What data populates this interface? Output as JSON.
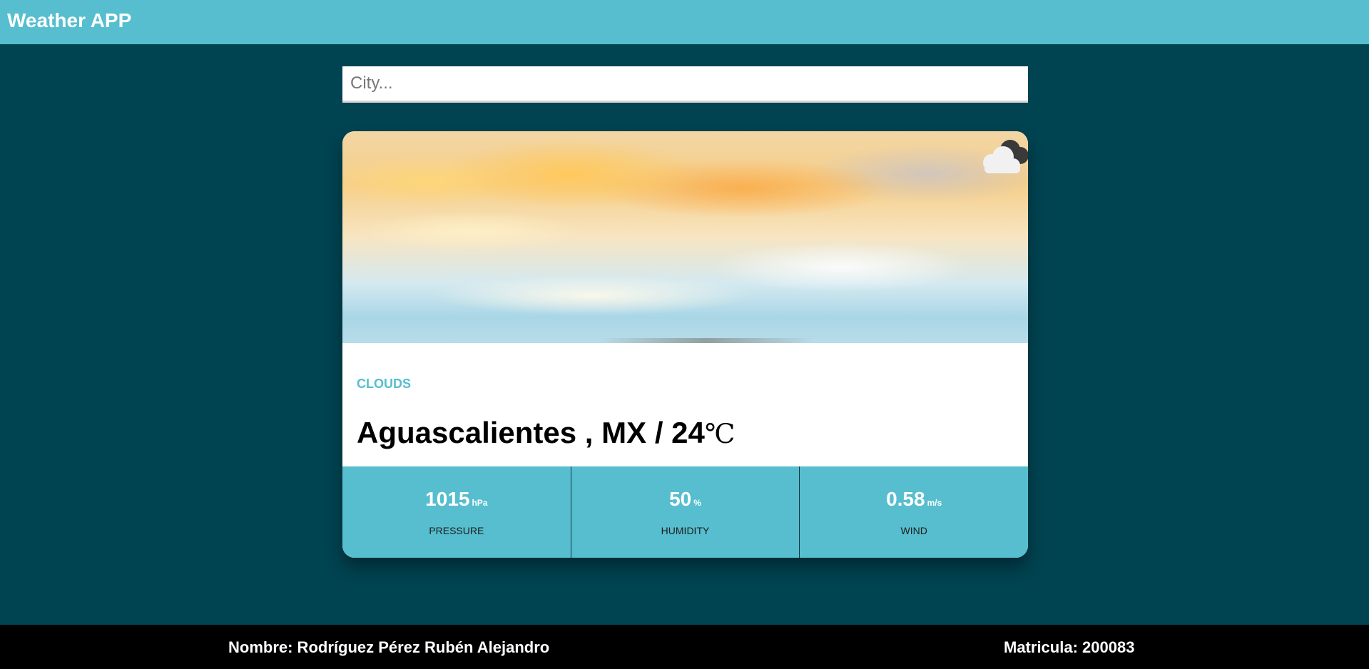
{
  "app": {
    "title": "Weather APP"
  },
  "search": {
    "placeholder": "City...",
    "value": ""
  },
  "weather": {
    "condition": "CLOUDS",
    "icon": "cloud-icon",
    "city": "Aguascalientes",
    "country": "MX",
    "temperature": "24",
    "temperature_unit": "℃",
    "separator_country": " , ",
    "separator_temp": " / "
  },
  "stats": [
    {
      "value": "1015",
      "unit": "hPa",
      "label": "PRESSURE"
    },
    {
      "value": "50",
      "unit": "%",
      "label": "HUMIDITY"
    },
    {
      "value": "0.58",
      "unit": "m/s",
      "label": "WIND"
    }
  ],
  "footer": {
    "name": "Nombre: Rodríguez Pérez Rubén Alejandro",
    "id": "Matricula: 200083"
  },
  "colors": {
    "header": "#56bece",
    "background": "#004351",
    "accent": "#56bece",
    "footer": "#000000"
  }
}
